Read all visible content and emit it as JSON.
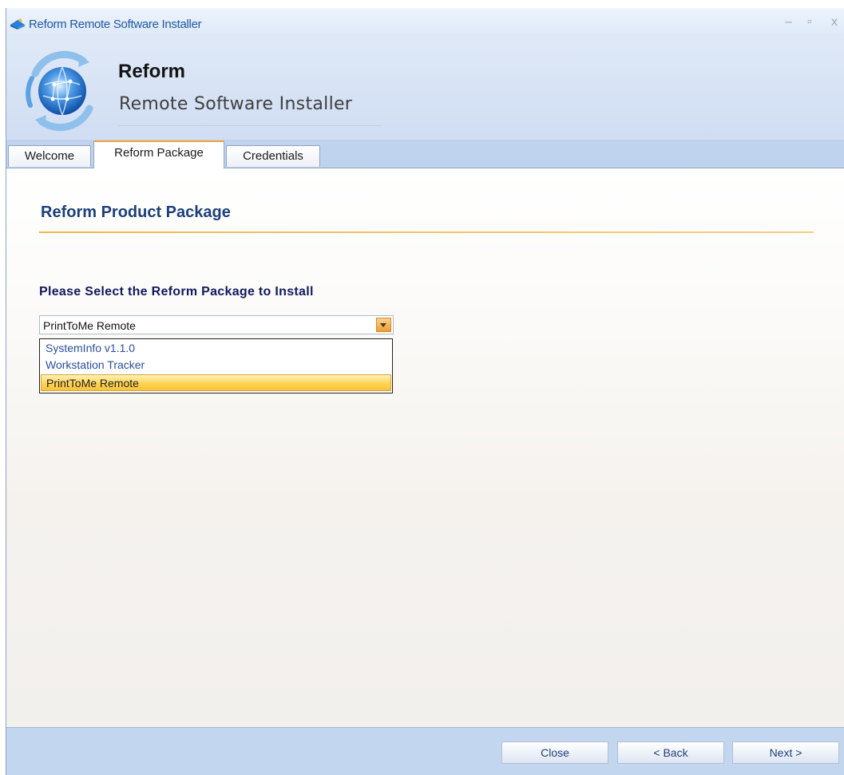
{
  "window": {
    "title": "Reform Remote Software Installer",
    "controls": {
      "minimize": "–",
      "maximize": "▫",
      "close": "x"
    }
  },
  "header": {
    "title": "Reform",
    "subtitle": "Remote Software Installer"
  },
  "tabs": [
    {
      "label": "Welcome",
      "active": false
    },
    {
      "label": "Reform Package",
      "active": true
    },
    {
      "label": "Credentials",
      "active": false
    }
  ],
  "main": {
    "section_title": "Reform Product Package",
    "select_label": "Please Select the Reform Package to Install",
    "combo": {
      "value": "PrintToMe Remote",
      "options": [
        "SystemInfo v1.1.0",
        "Workstation Tracker",
        "PrintToMe Remote"
      ],
      "highlighted_index": 2
    }
  },
  "footer": {
    "close_label": "Close",
    "back_label": "< Back",
    "next_label": "Next >"
  },
  "colors": {
    "accent": "#f0a53c",
    "title_text": "#1f58a6",
    "section_title": "#1c3f7a",
    "tabstrip": "#bfd3ef",
    "footer": "#c3d6f0"
  },
  "icons": {
    "app": "reform-installer-icon",
    "logo": "globe-arrows-logo",
    "dropdown": "chevron-down-icon"
  }
}
